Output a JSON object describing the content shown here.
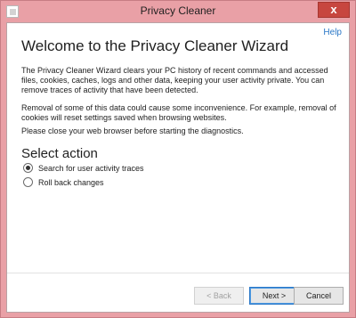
{
  "window": {
    "title": "Privacy Cleaner",
    "close_label": "x"
  },
  "help": {
    "label": "Help"
  },
  "wizard": {
    "heading": "Welcome to the Privacy Cleaner Wizard",
    "paragraph1": "The Privacy Cleaner Wizard clears your PC history of recent commands and accessed files, cookies, caches, logs and other data, keeping your user activity private. You can remove traces of activity that have been detected.",
    "paragraph2": "Removal of some of this data could cause some inconvenience. For example, removal of cookies will reset settings saved when browsing websites.",
    "paragraph3": "Please close your web browser before starting the diagnostics.",
    "select_action_heading": "Select action",
    "options": [
      {
        "label": "Search for user activity traces",
        "checked": true
      },
      {
        "label": "Roll back changes",
        "checked": false
      }
    ]
  },
  "buttons": {
    "back": "< Back",
    "next": "Next >",
    "cancel": "Cancel"
  },
  "colors": {
    "titlebar": "#e9a0a6",
    "close_button": "#c7463f",
    "link": "#2b78c7"
  }
}
